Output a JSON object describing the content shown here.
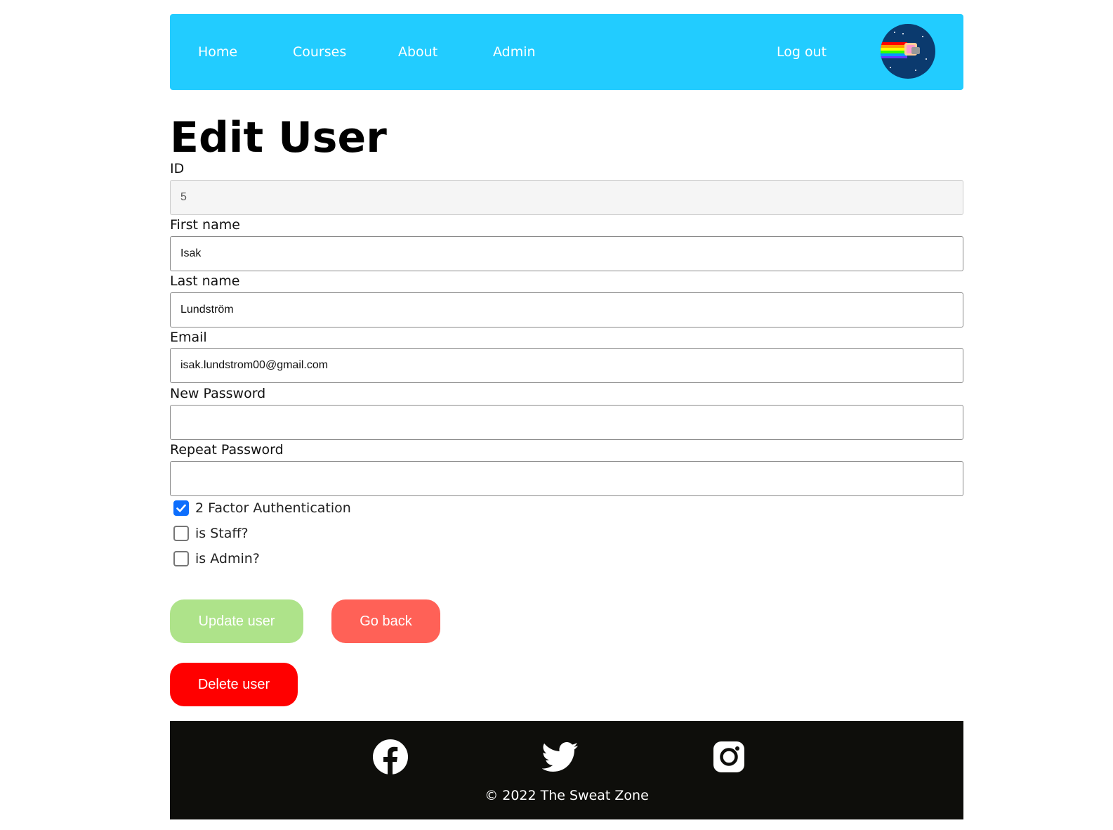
{
  "nav": {
    "home": "Home",
    "courses": "Courses",
    "about": "About",
    "admin": "Admin",
    "logout": "Log out"
  },
  "page": {
    "title": "Edit User"
  },
  "form": {
    "id_label": "ID",
    "id_value": "5",
    "first_name_label": "First name",
    "first_name_value": "Isak",
    "last_name_label": "Last name",
    "last_name_value": "Lundström",
    "email_label": "Email",
    "email_value": "isak.lundstrom00@gmail.com",
    "new_password_label": "New Password",
    "new_password_value": "",
    "repeat_password_label": "Repeat Password",
    "repeat_password_value": "",
    "two_factor_label": "2 Factor Authentication",
    "two_factor_checked": true,
    "is_staff_label": "is Staff?",
    "is_staff_checked": false,
    "is_admin_label": "is Admin?",
    "is_admin_checked": false
  },
  "buttons": {
    "update": "Update user",
    "back": "Go back",
    "delete": "Delete user"
  },
  "footer": {
    "copyright": "© 2022 The Sweat Zone",
    "icons": [
      "facebook-icon",
      "twitter-icon",
      "instagram-icon"
    ]
  },
  "colors": {
    "navbar": "#22ccff",
    "update_button": "#aee38a",
    "back_button": "#ff6157",
    "delete_button": "#ff0000",
    "footer": "#0e0e0b",
    "checkbox_checked": "#0d6efd"
  }
}
